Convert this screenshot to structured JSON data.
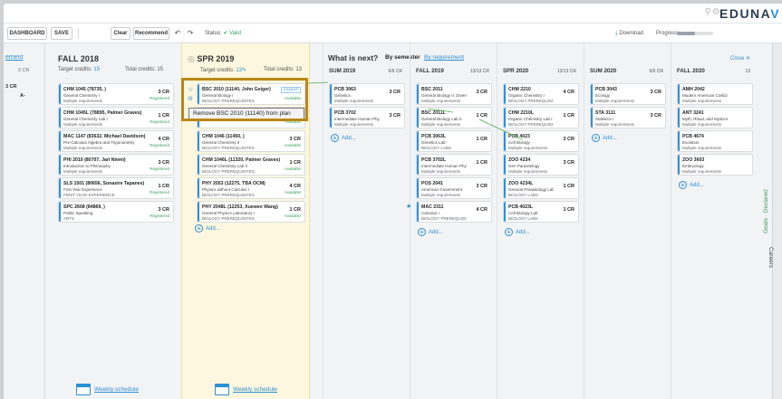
{
  "brand": {
    "logo_main": "EDUNA",
    "logo_last": "V",
    "search_icon": "search-icon",
    "settings_icon": "gear-icon"
  },
  "toolbar": {
    "dashboard": "DASHBOARD",
    "save": "SAVE",
    "clear": "Clear",
    "recommend": "Recommend",
    "status_label": "Status:",
    "status_value": "Valid",
    "download": "Download",
    "progress_label": "Progress:",
    "progress_fraction": 0.5
  },
  "left_partial": {
    "link": "ement",
    "credits": "3 CR",
    "row_cr": "3 CR",
    "row_grade": "A-"
  },
  "fall2018": {
    "title": "FALL 2018",
    "target_label": "Target credits:",
    "target_value": "15",
    "total": "Total credits: 15",
    "weekly": "Weekly schedule",
    "courses": [
      {
        "title": "CHM 1045 (78735, )",
        "l1": "General Chemistry I",
        "l2": "Multiple requirements",
        "cr": "3 CR",
        "st": "Registered"
      },
      {
        "title": "CHM 1045L (78895, Palmer Graves)",
        "l1": "General Chemistry Lab I",
        "l2": "Multiple requirements",
        "cr": "1 CR",
        "st": "Registered"
      },
      {
        "title": "MAC 1147 (83632, Michael Davidson)",
        "l1": "Pre-Calculus Algebra and Trigonometry",
        "l2": "Multiple requirements",
        "cr": "4 CR",
        "st": "Registered"
      },
      {
        "title": "PHI 2010 (80707, Jari Niemi)",
        "l1": "Introduction to Philosophy",
        "l2": "Multiple requirements",
        "cr": "3 CR",
        "st": "Registered"
      },
      {
        "title": "SLS 1501 (80656, Sonasire Tapanes)",
        "l1": "First Year Experience",
        "l2": "FIRST YEAR EXPERIENCE",
        "cr": "1 CR",
        "st": "Registered"
      },
      {
        "title": "SPC 2608 (84869, )",
        "l1": "Public Speaking",
        "l2": "ARTS",
        "cr": "3 CR",
        "st": "Registered"
      }
    ]
  },
  "spr2019": {
    "title": "SPR 2019",
    "target_label": "Target credits:",
    "target_value": "13",
    "total": "Total credits: 13",
    "weekly": "Weekly schedule",
    "add": "Add...",
    "tooltip": "Remove BSC 2010 (11140) from plan",
    "courses": [
      {
        "title": "BSC 2010 (11140, John Geiger)",
        "l1": "General Biology I",
        "l2": "BIOLOGY PREREQUISITES",
        "cr": "",
        "st": "Available",
        "change": "CHANGE"
      },
      {
        "title": "",
        "l1": "",
        "l2": "",
        "cr": "3 CR",
        "st": "Available"
      },
      {
        "title": "CHM 1046 (11450, )",
        "l1": "General Chemistry II",
        "l2": "BIOLOGY PREREQUISITES",
        "cr": "3 CR",
        "st": "Available"
      },
      {
        "title": "CHM 1046L (11320, Palmer Graves)",
        "l1": "General Chemistry Lab II",
        "l2": "BIOLOGY PREREQUISITES",
        "cr": "1 CR",
        "st": "Available"
      },
      {
        "title": "PHY 2053 (12275, TBA OCM)",
        "l1": "Physics without Calculus I",
        "l2": "BIOLOGY PREREQUISITES",
        "cr": "4 CR",
        "st": "Available"
      },
      {
        "title": "PHY 2048L (12253, Xuewen Wang)",
        "l1": "General Physics Laboratory I",
        "l2": "BIOLOGY PREREQUISITES",
        "cr": "1 CR",
        "st": "Available"
      }
    ]
  },
  "next": {
    "title": "What is next?",
    "tab_semester": "By semester",
    "tab_requirement": "By requirement",
    "close": "Close",
    "add": "Add...",
    "terms": [
      {
        "name": "SUM 2019",
        "cr": "6/6 CR",
        "courses": [
          {
            "title": "PCB 3063",
            "l1": "Genetics",
            "l2": "Multiple requirements",
            "cr": "3 CR"
          },
          {
            "title": "PCB 3702",
            "l1": "Intermediate Human Physiology",
            "l2": "Multiple requirements",
            "cr": "3 CR"
          }
        ]
      },
      {
        "name": "FALL 2019",
        "cr": "13/13 CR",
        "courses": [
          {
            "title": "BSC 2011",
            "l1": "General Biology II: Diversity of L...",
            "l2": "Multiple requirements",
            "cr": "3 CR"
          },
          {
            "title": "BSC 2011L",
            "l1": "General Biology Lab II",
            "l2": "Multiple requirements",
            "cr": "1 CR"
          },
          {
            "title": "PCB 3063L",
            "l1": "Genetics Lab",
            "l2": "BIOLOGY LABS",
            "cr": "1 CR"
          },
          {
            "title": "PCB 3702L",
            "l1": "Intermediate Human Physiolog...",
            "l2": "Multiple requirements",
            "cr": "1 CR"
          },
          {
            "title": "POS 2041",
            "l1": "American Government",
            "l2": "Multiple requirements",
            "cr": "3 CR"
          },
          {
            "title": "MAC 2311",
            "l1": "Calculus I",
            "l2": "BIOLOGY PREREQUISITES",
            "cr": "4 CR"
          }
        ]
      },
      {
        "name": "SPR 2020",
        "cr": "13/13 CR",
        "courses": [
          {
            "title": "CHM 2210",
            "l1": "Organic Chemistry I",
            "l2": "BIOLOGY PREREQUISITES",
            "cr": "4 CR"
          },
          {
            "title": "CHM 2210L",
            "l1": "Organic Chemistry Lab I",
            "l2": "BIOLOGY PREREQUISITES",
            "cr": "1 CR"
          },
          {
            "title": "PCB 4023",
            "l1": "Cell Biology",
            "l2": "Multiple requirements",
            "cr": "3 CR"
          },
          {
            "title": "ZOO 4234",
            "l1": "Gen Parasitology",
            "l2": "Multiple requirements",
            "cr": "3 CR"
          },
          {
            "title": "ZOO 4234L",
            "l1": "General Parasitology Lab",
            "l2": "BIOLOGY LABS",
            "cr": "1 CR"
          },
          {
            "title": "PCB 4023L",
            "l1": "Cell Biology Lab",
            "l2": "BIOLOGY LABS",
            "cr": "1 CR"
          }
        ]
      },
      {
        "name": "SUM 2020",
        "cr": "6/6 CR",
        "courses": [
          {
            "title": "PCB 3043",
            "l1": "Ecology",
            "l2": "Multiple requirements",
            "cr": "3 CR"
          },
          {
            "title": "STA 3111",
            "l1": "Statistics I",
            "l2": "Multiple requirements",
            "cr": "3 CR"
          }
        ]
      },
      {
        "name": "FALL 2020",
        "cr": "13",
        "courses": [
          {
            "title": "AMH 2042",
            "l1": "Modern American Civilizat...",
            "l2": "Multiple requirements",
            "cr": ""
          },
          {
            "title": "ANT 3241",
            "l1": "Myth, Ritual, and Mysticism",
            "l2": "Multiple requirements",
            "cr": ""
          },
          {
            "title": "PCB 4674",
            "l1": "Evolution",
            "l2": "Multiple requirements",
            "cr": ""
          },
          {
            "title": "ZOO 3603",
            "l1": "Embryology",
            "l2": "Multiple requirements",
            "cr": ""
          }
        ]
      }
    ]
  },
  "sidebar": {
    "goals": "Goals · Declared",
    "careers": "Careers"
  },
  "colors": {
    "accent": "#2d8fd6",
    "ok": "#3aa35a",
    "highlight": "#b98816",
    "arrow": "#4caf50"
  }
}
